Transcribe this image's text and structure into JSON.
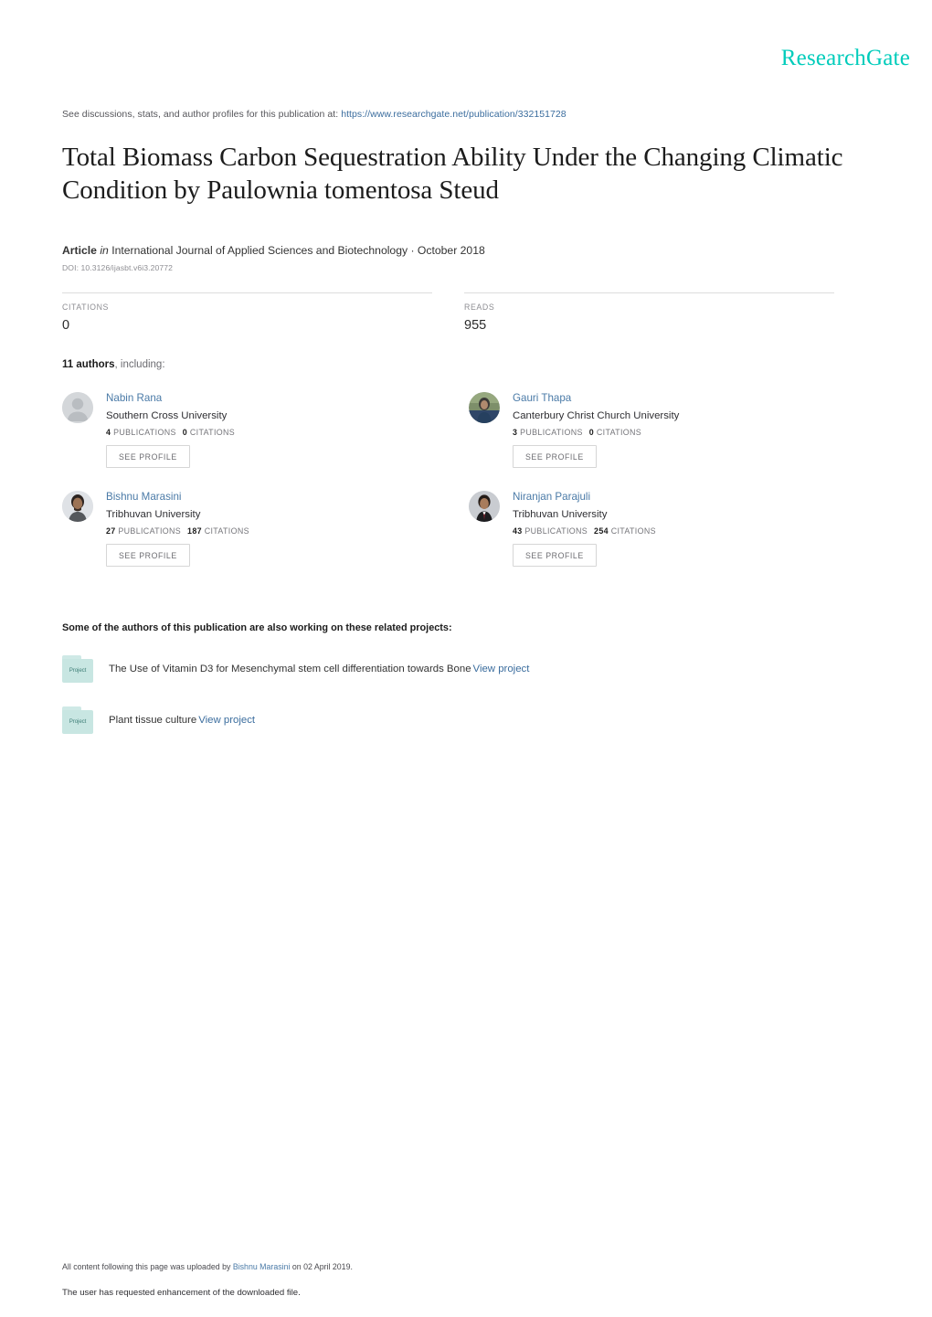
{
  "brand": {
    "logo_text": "ResearchGate",
    "accent_color": "#00ccbb",
    "link_color": "#3b6d9e"
  },
  "header": {
    "see_discussions_prefix": "See discussions, stats, and author profiles for this publication at:",
    "publication_url": "https://www.researchgate.net/publication/332151728"
  },
  "publication": {
    "title": "Total Biomass Carbon Sequestration Ability Under the Changing Climatic Condition by Paulownia tomentosa Steud",
    "type_label": "Article",
    "in_label": "in",
    "journal_and_date": "International Journal of Applied Sciences and Biotechnology · October 2018",
    "doi": "DOI: 10.3126/ijasbt.v6i3.20772"
  },
  "stats": {
    "citations_label": "CITATIONS",
    "citations_value": "0",
    "reads_label": "READS",
    "reads_value": "955"
  },
  "authors_section": {
    "count_bold": "11 authors",
    "count_rest": ", including:",
    "see_profile_label": "SEE PROFILE",
    "publications_label": "PUBLICATIONS",
    "citations_label": "CITATIONS",
    "authors": [
      {
        "name": "Nabin Rana",
        "affiliation": "Southern Cross University",
        "publications": "4",
        "citations": "0",
        "avatar_type": "placeholder"
      },
      {
        "name": "Gauri Thapa",
        "affiliation": "Canterbury Christ Church University",
        "publications": "3",
        "citations": "0",
        "avatar_type": "photo-green"
      },
      {
        "name": "Bishnu Marasini",
        "affiliation": "Tribhuvan University",
        "publications": "27",
        "citations": "187",
        "avatar_type": "photo-warm"
      },
      {
        "name": "Niranjan Parajuli",
        "affiliation": "Tribhuvan University",
        "publications": "43",
        "citations": "254",
        "avatar_type": "photo-dark"
      }
    ]
  },
  "related_projects": {
    "heading": "Some of the authors of this publication are also working on these related projects:",
    "icon_label": "Project",
    "view_project_label": "View project",
    "items": [
      {
        "title": "The Use of Vitamin D3 for Mesenchymal stem cell differentiation towards Bone"
      },
      {
        "title": "Plant tissue culture"
      }
    ]
  },
  "footer": {
    "uploaded_prefix": "All content following this page was uploaded by",
    "uploaded_by": "Bishnu Marasini",
    "uploaded_suffix": "on 02 April 2019.",
    "enhancement_note": "The user has requested enhancement of the downloaded file."
  }
}
